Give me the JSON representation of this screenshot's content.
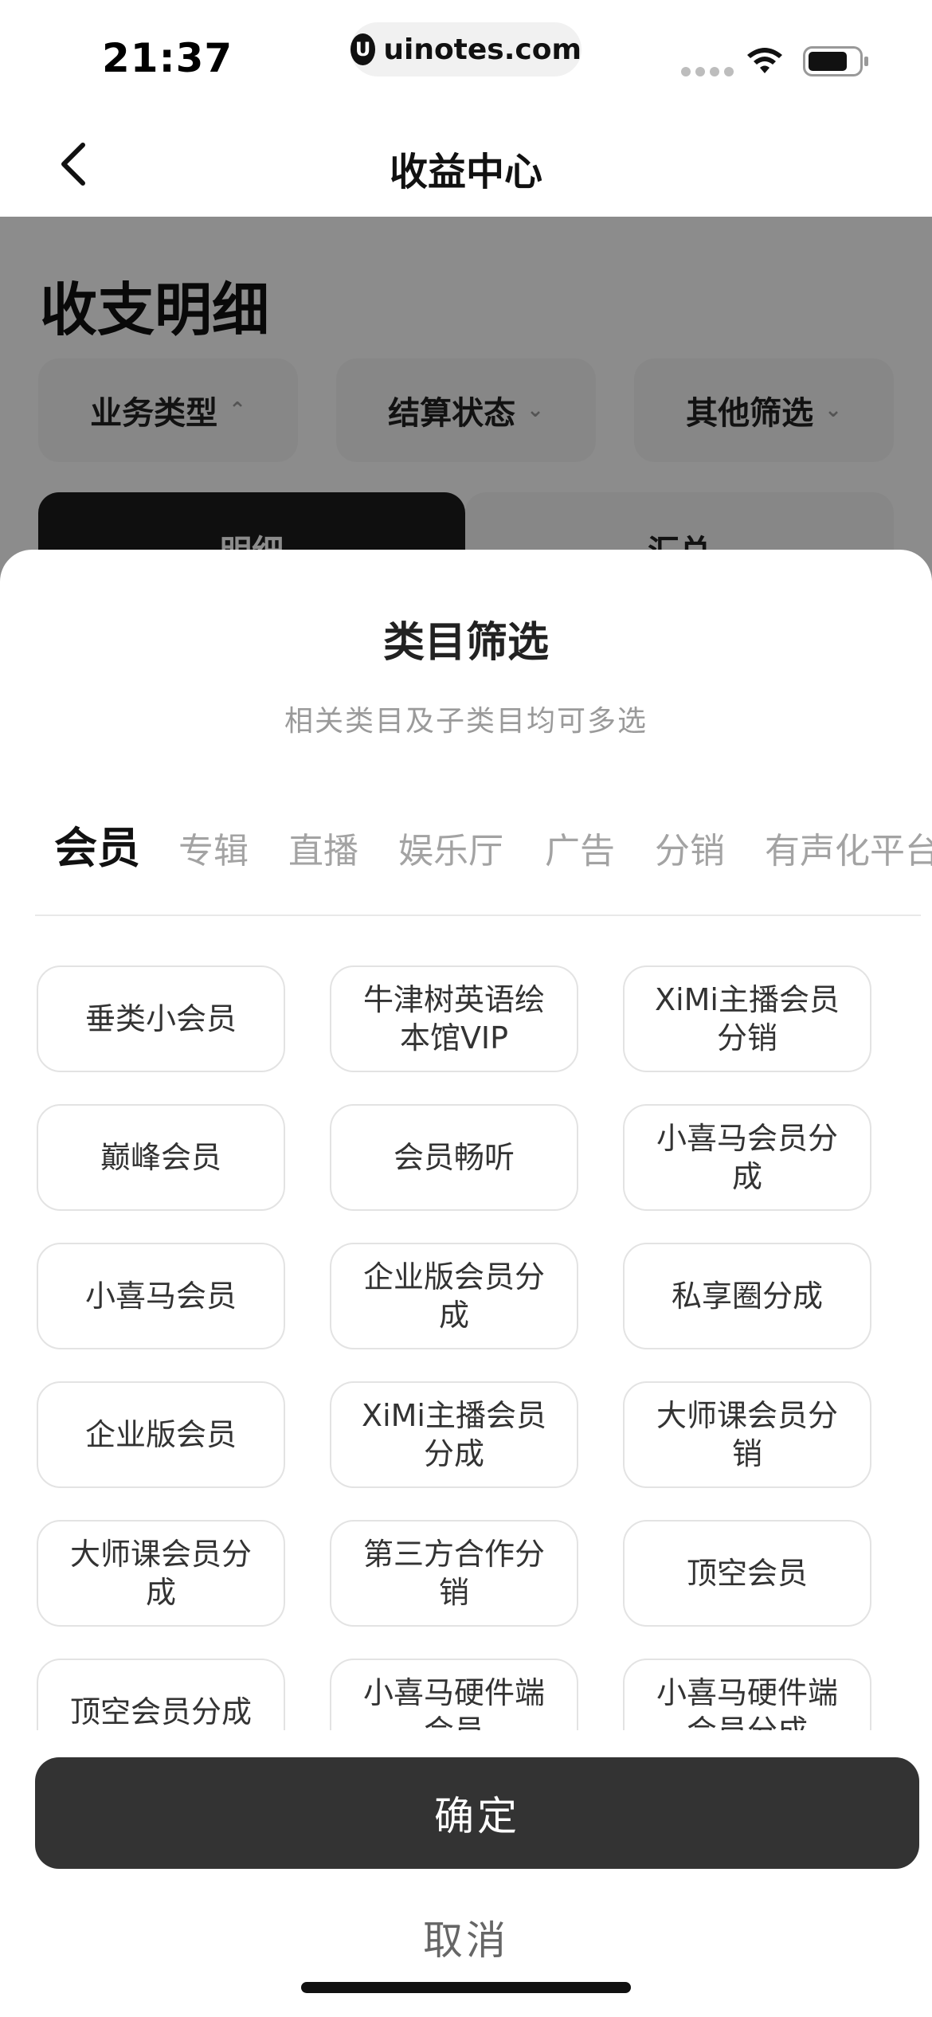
{
  "status_bar": {
    "time": "21:37",
    "url": "uinotes.com",
    "logo_glyph": "U"
  },
  "nav": {
    "title": "收益中心"
  },
  "background_page": {
    "title": "收支明细",
    "filters": [
      {
        "label": "业务类型",
        "arrow": "⌃"
      },
      {
        "label": "结算状态",
        "arrow": "⌄"
      },
      {
        "label": "其他筛选",
        "arrow": "⌄"
      }
    ],
    "segments": [
      "明细",
      "汇总"
    ]
  },
  "sheet": {
    "title": "类目筛选",
    "subtitle": "相关类目及子类目均可多选",
    "tabs": [
      "会员",
      "专辑",
      "直播",
      "娱乐厅",
      "广告",
      "分销",
      "有声化平台"
    ],
    "active_tab": "会员",
    "options": [
      [
        "垂类小会员",
        "牛津树英语绘本馆VIP",
        "XiMi主播会员分销"
      ],
      [
        "巅峰会员",
        "会员畅听",
        "小喜马会员分成"
      ],
      [
        "小喜马会员",
        "企业版会员分成",
        "私享圈分成"
      ],
      [
        "企业版会员",
        "XiMi主播会员分成",
        "大师课会员分销"
      ],
      [
        "大师课会员分成",
        "第三方合作分销",
        "顶空会员"
      ],
      [
        "顶空会员分成",
        "小喜马硬件端会员",
        "小喜马硬件端会员分成"
      ]
    ],
    "confirm_label": "确定",
    "cancel_label": "取消"
  },
  "colors": {
    "primary_button": "#333333",
    "active_tab": "#111111",
    "inactive_tab": "#a3a3a3",
    "overlay": "rgba(0,0,0,0.45)"
  }
}
